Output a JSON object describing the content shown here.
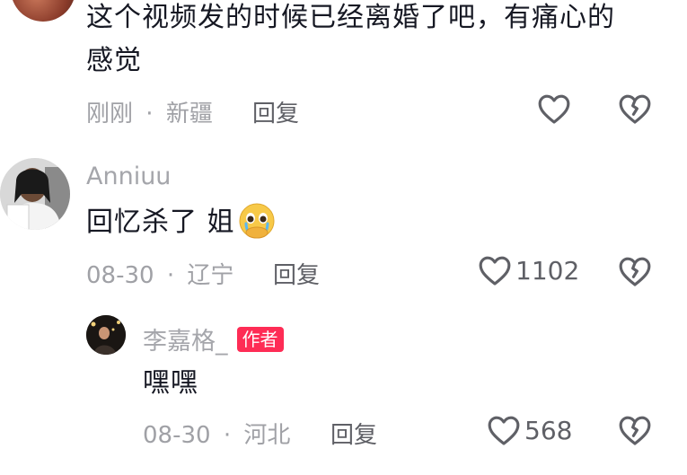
{
  "comments": [
    {
      "text": "这个视频发的时候已经离婚了吧，有痛心的感觉",
      "time": "刚刚",
      "location": "新疆",
      "reply_label": "回复",
      "likes": ""
    },
    {
      "username": "Anniuu",
      "text": "回忆杀了 姐",
      "emoji": "🥹",
      "time": "08-30",
      "location": "辽宁",
      "reply_label": "回复",
      "likes": "1102"
    }
  ],
  "reply": {
    "username": "李嘉格_",
    "author_badge": "作者",
    "text": "嘿嘿",
    "time": "08-30",
    "location": "河北",
    "reply_label": "回复",
    "likes": "568"
  },
  "separator": "·",
  "colors": {
    "badge": "#fe2c55",
    "text": "#161823",
    "meta": "#a0a1a6",
    "icon": "#5f6066"
  },
  "icons": [
    "heart-outline-icon",
    "broken-heart-icon",
    "crying-face-emoji"
  ]
}
